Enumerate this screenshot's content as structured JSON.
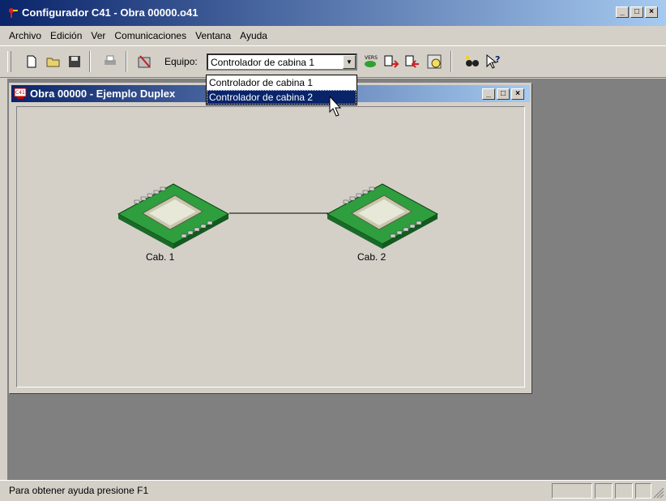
{
  "window": {
    "title": "Configurador C41 - Obra 00000.o41"
  },
  "menu": [
    "Archivo",
    "Edición",
    "Ver",
    "Comunicaciones",
    "Ventana",
    "Ayuda"
  ],
  "toolbar": {
    "equipo_label": "Equipo:",
    "equipo_value": "Controlador de cabina 1",
    "dropdown_options": [
      "Controlador de cabina 1",
      "Controlador de cabina 2"
    ],
    "selected_option_index": 1
  },
  "child_window": {
    "title": "Obra 00000 - Ejemplo Duplex"
  },
  "nodes": [
    "Cab. 1",
    "Cab. 2"
  ],
  "status": {
    "text": "Para obtener ayuda presione F1"
  },
  "colors": {
    "title_active": "#0a246a",
    "face": "#d4d0c8",
    "mdi_bg": "#808080",
    "board_green": "#3cb44a"
  }
}
